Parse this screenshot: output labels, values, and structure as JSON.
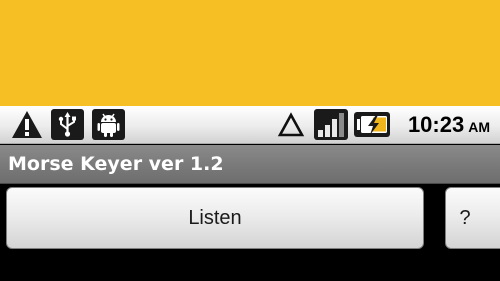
{
  "top_area": {
    "color": "#f6bf24"
  },
  "status_bar": {
    "left_icons": [
      "warning-icon",
      "usb-icon",
      "android-debug-icon"
    ],
    "right_icons": [
      "no-data-triangle-icon",
      "signal-icon",
      "battery-charging-icon"
    ],
    "time": "10:23",
    "ampm": "AM"
  },
  "title_bar": {
    "title": "Morse Keyer ver 1.2"
  },
  "buttons": {
    "listen_label": "Listen",
    "help_label": "?"
  }
}
